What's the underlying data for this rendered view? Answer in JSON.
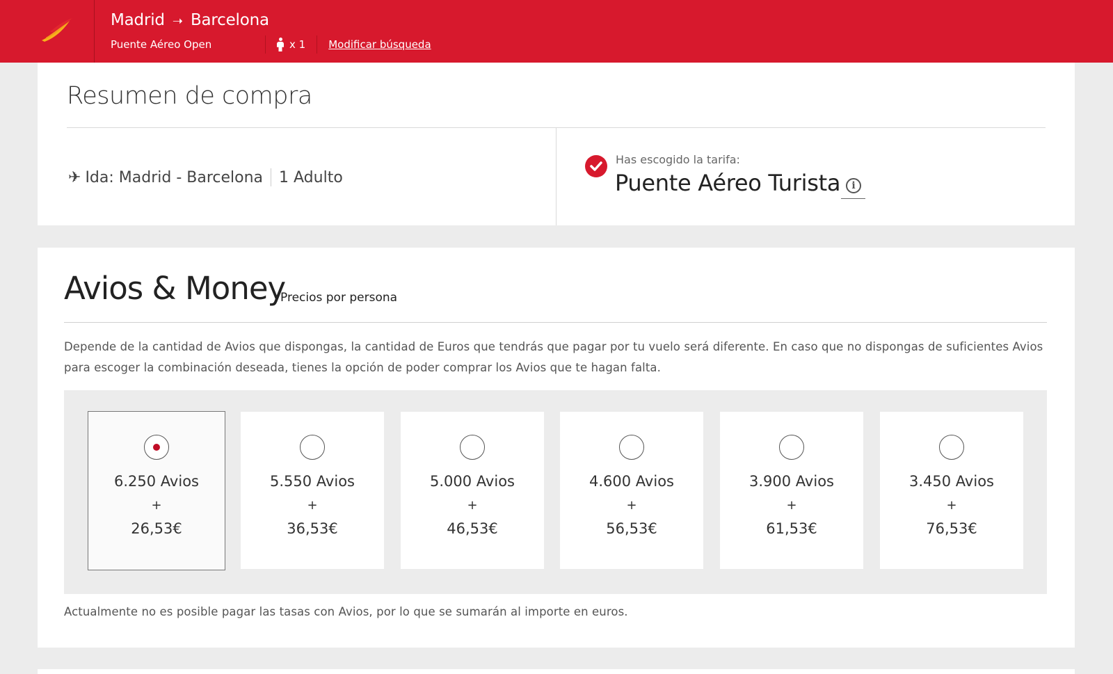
{
  "header": {
    "brand_color": "#d7192d",
    "origin": "Madrid",
    "destination": "Barcelona",
    "fare_type": "Puente Aéreo Open",
    "passengers": "x 1",
    "modify_label": "Modificar búsqueda"
  },
  "summary": {
    "title": "Resumen de compra",
    "trip": "Ida: Madrid - Barcelona",
    "travellers": "1 Adulto",
    "fare_label": "Has escogido la tarifa:",
    "fare_name": "Puente Aéreo Turista"
  },
  "avios": {
    "title": "Avios & Money",
    "subtitle": "Precios por persona",
    "description": "Depende de la cantidad de Avios que dispongas, la cantidad de Euros que tendrás que pagar por tu vuelo será diferente. En caso que no dispongas de suficientes Avios para escoger la combinación deseada, tienes la opción de poder comprar los Avios que te hagan falta.",
    "plus": "+",
    "options": [
      {
        "avios": "6.250 Avios",
        "money": "26,53€",
        "selected": true
      },
      {
        "avios": "5.550 Avios",
        "money": "36,53€",
        "selected": false
      },
      {
        "avios": "5.000 Avios",
        "money": "46,53€",
        "selected": false
      },
      {
        "avios": "4.600 Avios",
        "money": "56,53€",
        "selected": false
      },
      {
        "avios": "3.900 Avios",
        "money": "61,53€",
        "selected": false
      },
      {
        "avios": "3.450 Avios",
        "money": "76,53€",
        "selected": false
      }
    ],
    "footnote": "Actualmente no es posible pagar las tasas con Avios, por lo que se sumarán al importe en euros."
  }
}
